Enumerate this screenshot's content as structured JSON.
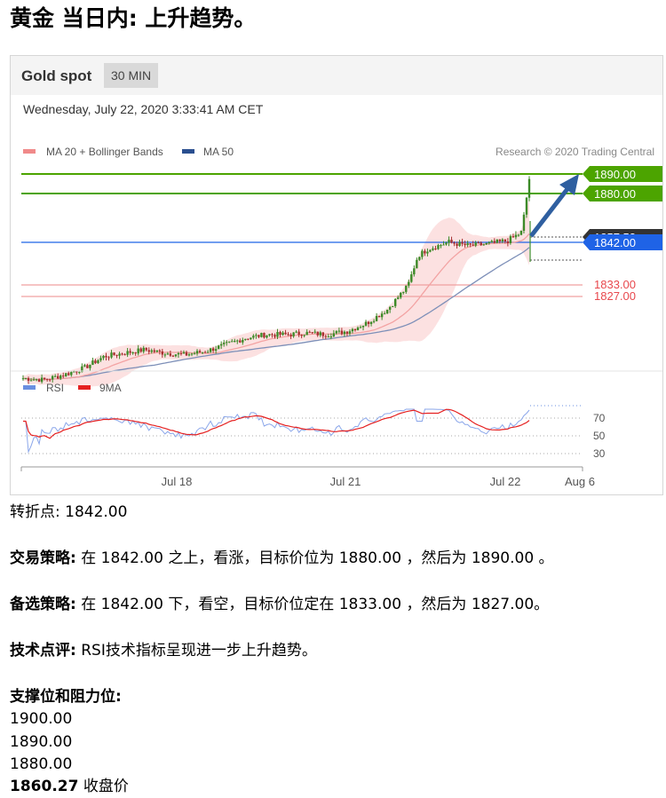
{
  "page": {
    "title": "黄金 当日内: 上升趋势。"
  },
  "chart": {
    "asset": "Gold spot",
    "timeframe": "30 MIN",
    "date": "Wednesday, July 22, 2020 3:33:41 AM CET",
    "legend": {
      "ma20": "MA 20 + Bollinger Bands",
      "ma50": "MA 50",
      "source": "Research © 2020 Trading Central"
    },
    "price_labels": {
      "target2": "1890.00",
      "target1": "1880.00",
      "last": "1857.53",
      "pivot": "1842.00",
      "support1": "1833.00",
      "support2": "1827.00"
    },
    "rsi_legend": {
      "rsi": "RSI",
      "ma": "9MA"
    },
    "rsi_ticks": [
      "70",
      "50",
      "30"
    ],
    "x_ticks": [
      "Jul 18",
      "Jul 21",
      "Jul 22",
      "Aug 6"
    ],
    "colors": {
      "green": "#4ca400",
      "blue": "#1f63e6",
      "red": "#e8484d",
      "dark": "#333333",
      "arrow": "#2f5fa0",
      "candle_up": "#3c8a28",
      "candle_down": "#a83030",
      "band": "#fcdcdc"
    }
  },
  "chart_data": {
    "type": "candlestick",
    "price_levels": [
      1890.0,
      1880.0,
      1857.53,
      1842.0,
      1833.0,
      1827.0
    ],
    "price_anchor_y": {
      "1890": 195,
      "1880": 217,
      "1857.53": 266,
      "1842": 272,
      "1833": 320,
      "1827": 333
    },
    "x_tick_labels": [
      "Jul 18",
      "Jul 21",
      "Jul 22",
      "Aug 6"
    ],
    "rsi_levels": [
      70,
      50,
      30
    ],
    "close_path": [
      [
        0,
        1801.5
      ],
      [
        0.04,
        1801
      ],
      [
        0.08,
        1802.5
      ],
      [
        0.12,
        1804.5
      ],
      [
        0.16,
        1808
      ],
      [
        0.2,
        1809
      ],
      [
        0.24,
        1810
      ],
      [
        0.28,
        1809
      ],
      [
        0.32,
        1808.5
      ],
      [
        0.36,
        1809.5
      ],
      [
        0.4,
        1811.5
      ],
      [
        0.44,
        1813.5
      ],
      [
        0.48,
        1814.5
      ],
      [
        0.52,
        1814.5
      ],
      [
        0.56,
        1815
      ],
      [
        0.6,
        1814.5
      ],
      [
        0.64,
        1815.5
      ],
      [
        0.68,
        1818
      ],
      [
        0.72,
        1822
      ],
      [
        0.76,
        1829
      ],
      [
        0.78,
        1838
      ],
      [
        0.8,
        1840
      ],
      [
        0.84,
        1842
      ],
      [
        0.88,
        1841
      ],
      [
        0.92,
        1841.5
      ],
      [
        0.96,
        1842.5
      ],
      [
        0.985,
        1844.5
      ],
      [
        1.0,
        1857.5
      ]
    ]
  },
  "commentary": {
    "pivot_label": "转折点:",
    "pivot_value": "1842.00",
    "strategy_label": "交易策略:",
    "strategy_text": "在 1842.00 之上，看涨，目标价位为 1880.00 ，然后为 1890.00 。",
    "alt_label": "备选策略:",
    "alt_text": "在 1842.00 下，看空，目标价位定在 1833.00 ，然后为 1827.00。",
    "tech_label": "技术点评:",
    "tech_text": "RSI技术指标呈现进一步上升趋势。",
    "levels_label": "支撑位和阻力位:",
    "levels": [
      "1900.00",
      "1890.00",
      "1880.00"
    ],
    "close_value": "1860.27",
    "close_label": "收盘价"
  }
}
